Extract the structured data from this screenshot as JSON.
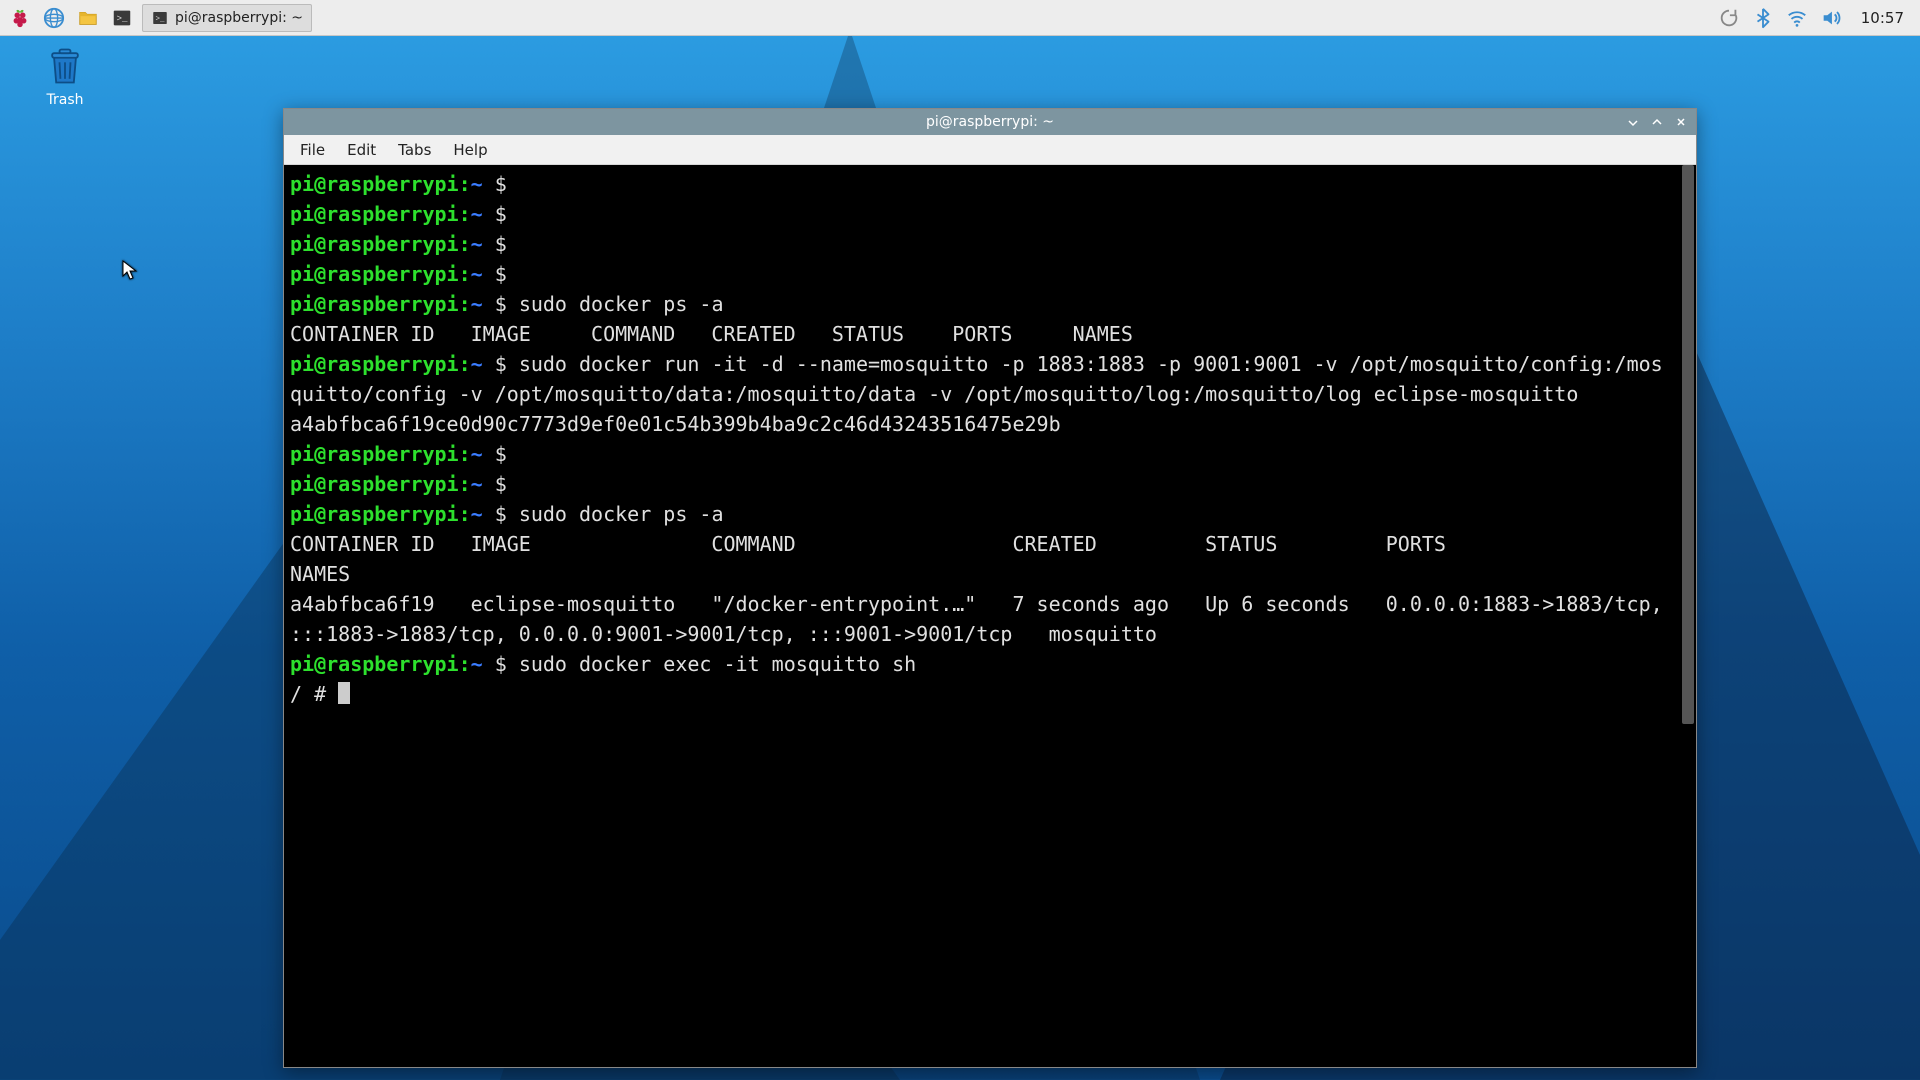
{
  "taskbar": {
    "active_task_label": "pi@raspberrypi: ~",
    "clock": "10:57"
  },
  "desktop": {
    "trash_label": "Trash"
  },
  "window": {
    "title": "pi@raspberrypi: ~",
    "menu": {
      "file": "File",
      "edit": "Edit",
      "tabs": "Tabs",
      "help": "Help"
    }
  },
  "terminal": {
    "prompt_user": "pi@raspberrypi",
    "prompt_path": "~",
    "lines": [
      {
        "type": "prompt",
        "cmd": ""
      },
      {
        "type": "prompt",
        "cmd": ""
      },
      {
        "type": "prompt",
        "cmd": ""
      },
      {
        "type": "prompt",
        "cmd": ""
      },
      {
        "type": "prompt",
        "cmd": "sudo docker ps -a"
      },
      {
        "type": "out",
        "text": "CONTAINER ID   IMAGE     COMMAND   CREATED   STATUS    PORTS     NAMES"
      },
      {
        "type": "prompt",
        "cmd": "sudo docker run -it -d --name=mosquitto -p 1883:1883 -p 9001:9001 -v /opt/mosquitto/config:/mosquitto/config -v /opt/mosquitto/data:/mosquitto/data -v /opt/mosquitto/log:/mosquitto/log eclipse-mosquitto"
      },
      {
        "type": "out",
        "text": "a4abfbca6f19ce0d90c7773d9ef0e01c54b399b4ba9c2c46d43243516475e29b"
      },
      {
        "type": "prompt",
        "cmd": ""
      },
      {
        "type": "prompt",
        "cmd": ""
      },
      {
        "type": "prompt",
        "cmd": "sudo docker ps -a"
      },
      {
        "type": "out",
        "text": "CONTAINER ID   IMAGE               COMMAND                  CREATED         STATUS         PORTS                                                                                      NAMES"
      },
      {
        "type": "out",
        "text": "a4abfbca6f19   eclipse-mosquitto   \"/docker-entrypoint.…\"   7 seconds ago   Up 6 seconds   0.0.0.0:1883->1883/tcp, :::1883->1883/tcp, 0.0.0.0:9001->9001/tcp, :::9001->9001/tcp   mosquitto"
      },
      {
        "type": "prompt",
        "cmd": "sudo docker exec -it mosquitto sh"
      },
      {
        "type": "root",
        "text": "/ # "
      }
    ]
  }
}
